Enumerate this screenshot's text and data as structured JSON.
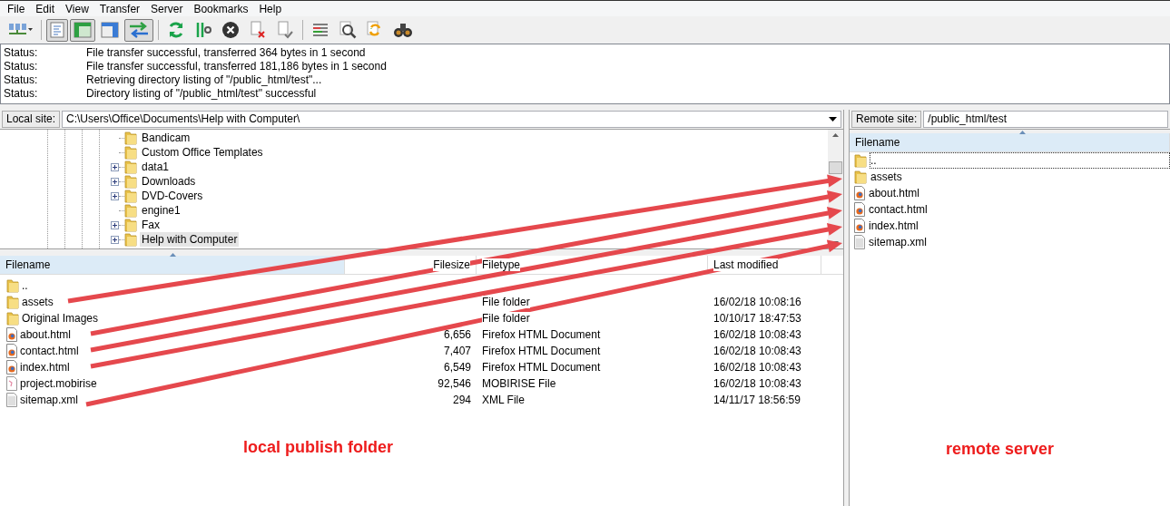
{
  "menu": [
    "File",
    "Edit",
    "View",
    "Transfer",
    "Server",
    "Bookmarks",
    "Help"
  ],
  "toolbar": [
    {
      "pressed": false
    },
    {
      "pressed": true
    },
    {
      "pressed": true
    },
    {
      "pressed": false
    },
    {
      "pressed": true
    },
    {
      "pressed": false
    },
    {
      "pressed": false
    },
    {
      "pressed": false
    },
    {
      "pressed": false
    },
    {
      "pressed": false
    },
    {
      "pressed": false
    },
    {
      "pressed": false
    },
    {
      "pressed": false
    },
    {
      "pressed": false
    }
  ],
  "log": [
    {
      "label": "Status:",
      "message": "File transfer successful, transferred 364 bytes in 1 second"
    },
    {
      "label": "Status:",
      "message": "File transfer successful, transferred 181,186 bytes in 1 second"
    },
    {
      "label": "Status:",
      "message": "Retrieving directory listing of \"/public_html/test\"..."
    },
    {
      "label": "Status:",
      "message": "Directory listing of \"/public_html/test\" successful"
    }
  ],
  "local": {
    "site_label": "Local site:",
    "path": "C:\\Users\\Office\\Documents\\Help with Computer\\",
    "tree": [
      {
        "name": "Bandicam",
        "expandable": false,
        "selected": false
      },
      {
        "name": "Custom Office Templates",
        "expandable": false,
        "selected": false
      },
      {
        "name": "data1",
        "expandable": true,
        "selected": false
      },
      {
        "name": "Downloads",
        "expandable": true,
        "selected": false
      },
      {
        "name": "DVD-Covers",
        "expandable": true,
        "selected": false
      },
      {
        "name": "engine1",
        "expandable": false,
        "selected": false
      },
      {
        "name": "Fax",
        "expandable": true,
        "selected": false
      },
      {
        "name": "Help with Computer",
        "expandable": true,
        "selected": true
      }
    ],
    "columns": [
      "Filename",
      "Filesize",
      "Filetype",
      "Last modified"
    ],
    "rows": [
      {
        "kind": "folder",
        "name": "..",
        "size": "",
        "type": "",
        "modified": ""
      },
      {
        "kind": "folder",
        "name": "assets",
        "type": "File folder",
        "modified": "16/02/18 10:08:16"
      },
      {
        "kind": "folder",
        "name": "Original Images",
        "type": "File folder",
        "modified": "10/10/17 18:47:53"
      },
      {
        "kind": "html",
        "name": "about.html",
        "size": "6,656",
        "type": "Firefox HTML Document",
        "modified": "16/02/18 10:08:43"
      },
      {
        "kind": "html",
        "name": "contact.html",
        "size": "7,407",
        "type": "Firefox HTML Document",
        "modified": "16/02/18 10:08:43"
      },
      {
        "kind": "html",
        "name": "index.html",
        "size": "6,549",
        "type": "Firefox HTML Document",
        "modified": "16/02/18 10:08:43"
      },
      {
        "kind": "mobirise",
        "name": "project.mobirise",
        "size": "92,546",
        "type": "MOBIRISE File",
        "modified": "16/02/18 10:08:43"
      },
      {
        "kind": "xml",
        "name": "sitemap.xml",
        "size": "294",
        "type": "XML File",
        "modified": "14/11/17 18:56:59"
      }
    ],
    "annotation": "local publish folder"
  },
  "remote": {
    "site_label": "Remote site:",
    "path": "/public_html/test",
    "columns": [
      "Filename"
    ],
    "rows": [
      {
        "kind": "folder",
        "name": "..",
        "selected": true
      },
      {
        "kind": "folder",
        "name": "assets",
        "selected": false
      },
      {
        "kind": "html",
        "name": "about.html",
        "selected": false
      },
      {
        "kind": "html",
        "name": "contact.html",
        "selected": false
      },
      {
        "kind": "html",
        "name": "index.html",
        "selected": false
      },
      {
        "kind": "xml",
        "name": "sitemap.xml",
        "selected": false
      }
    ],
    "annotation": "remote server"
  }
}
